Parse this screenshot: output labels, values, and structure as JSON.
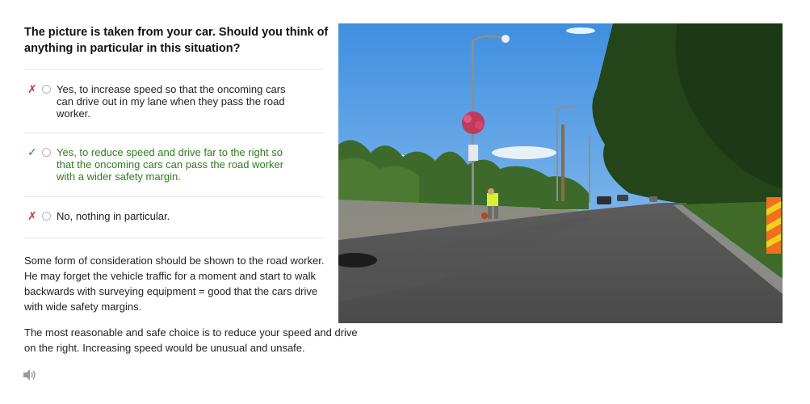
{
  "question": "The picture is taken from your car. Should you think of anything in particular in this situation?",
  "options": [
    {
      "mark": "✗",
      "status": "wrong",
      "text": "Yes, to increase speed so that the oncoming cars can drive out in my lane when they pass the road worker."
    },
    {
      "mark": "✓",
      "status": "correct",
      "text": "Yes, to reduce speed and drive far to the right so that the oncoming cars can pass the road worker with a wider safety margin."
    },
    {
      "mark": "✗",
      "status": "wrong",
      "text": "No, nothing in particular."
    }
  ],
  "explanation": [
    "Some form of consideration should be shown to the road worker. He may forget the vehicle traffic for a moment and start to walk backwards with surveying equipment = good that the cars drive with wide safety margins.",
    "The most reasonable and safe choice is to reduce your speed and drive on the right. Increasing speed would be unusual and unsafe."
  ],
  "colors": {
    "wrong": "#d9302c",
    "correct": "#2e7d1e",
    "sky": "#5aa3e6",
    "trees": "#2f5a22"
  },
  "icons": {
    "audio": "speaker-icon"
  }
}
